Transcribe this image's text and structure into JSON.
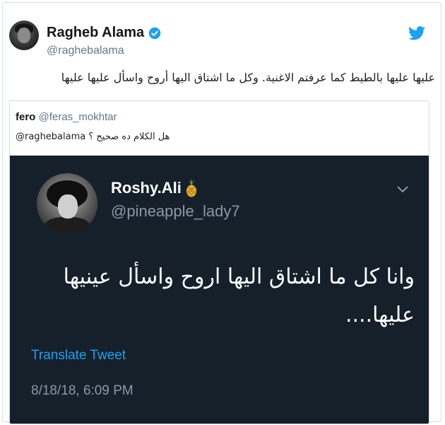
{
  "tweet": {
    "author_name": "Ragheb Alama",
    "author_handle": "@raghebalama",
    "text": "عليها عليها بالطيط كما عرفتم الاغنية. وكل ما اشتاق اليها أروح واسأل عليها عليها",
    "icons": {
      "avatar": "user-avatar",
      "verified": "verified-badge-icon",
      "platform": "twitter-bird-icon"
    },
    "colors": {
      "verified": "#1da1f2",
      "twitter": "#1da1f2"
    }
  },
  "quoted_tweet": {
    "author_name": "fero",
    "author_handle": "@feras_mokhtar",
    "text": "@raghebalama هل الكلام ده صحيح ؟",
    "screenshot": {
      "author_name": "Roshy.Ali",
      "author_handle": "@pineapple_lady7",
      "text": "وانا كل ما اشتاق اليها اروح واسأل عينيها عليها....",
      "translate_label": "Translate Tweet",
      "timestamp": "8/18/18, 6:09 PM",
      "icons": {
        "name_emoji": "pineapple-icon",
        "menu": "chevron-down-icon"
      },
      "colors": {
        "background": "#15202b",
        "link": "#1da1f2"
      }
    }
  }
}
